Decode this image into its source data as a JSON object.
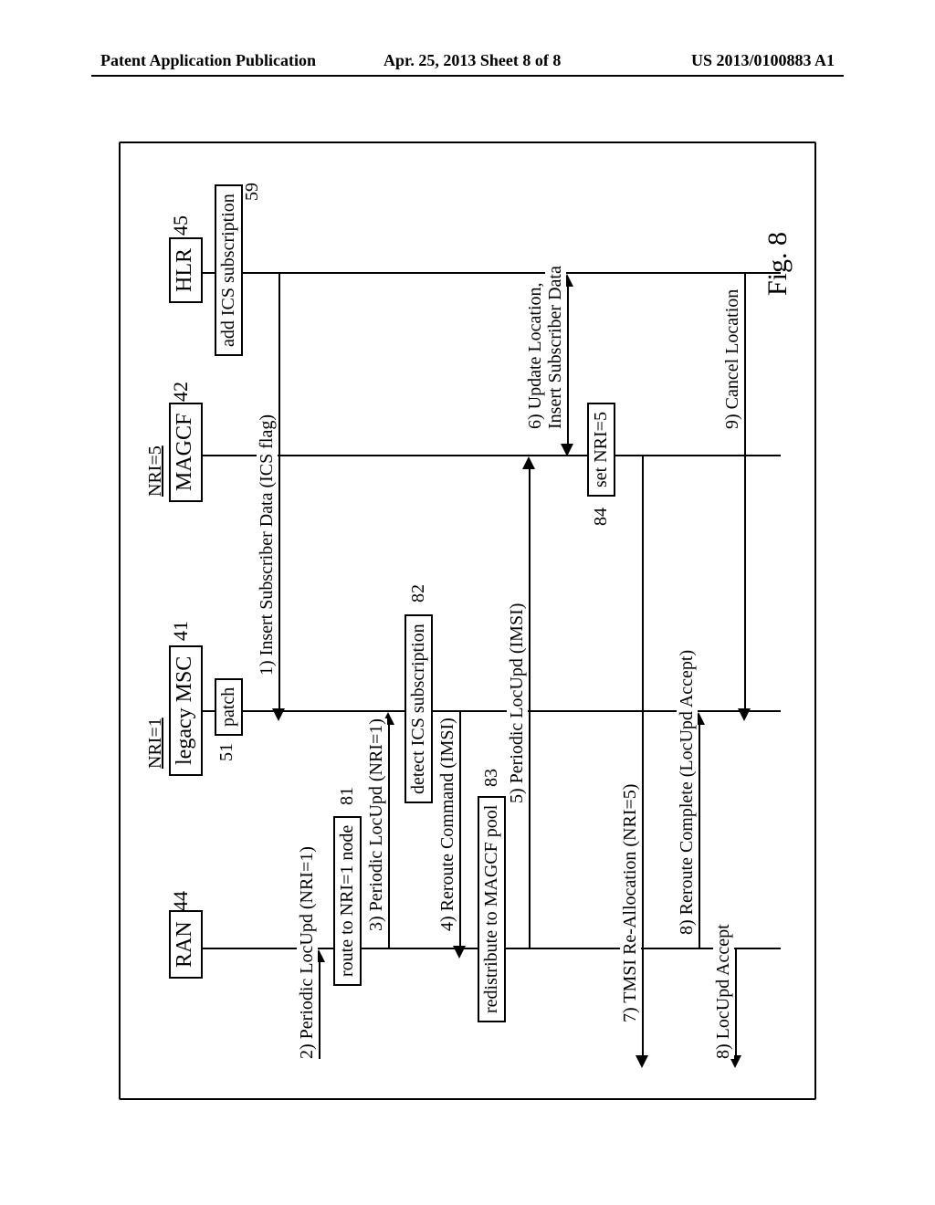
{
  "header": {
    "left": "Patent Application Publication",
    "center": "Apr. 25, 2013  Sheet 8 of 8",
    "right": "US 2013/0100883 A1"
  },
  "nodes": {
    "ran": {
      "label": "RAN",
      "num": "44",
      "nri": ""
    },
    "msc": {
      "label": "legacy MSC",
      "num": "41",
      "nri": "NRI=1"
    },
    "magcf": {
      "label": "MAGCF",
      "num": "42",
      "nri": "NRI=5"
    },
    "hlr": {
      "label": "HLR",
      "num": "45",
      "nri": ""
    }
  },
  "actions": {
    "patch": {
      "label": "patch",
      "num": "51"
    },
    "add_ics": {
      "label": "add ICS subscription",
      "num": "59"
    },
    "route_nri1": {
      "label": "route to NRI=1 node",
      "num": "81"
    },
    "detect_ics": {
      "label": "detect ICS subscription",
      "num": "82"
    },
    "redistribute": {
      "label": "redistribute to MAGCF pool",
      "num": "83"
    },
    "set_nri5": {
      "label": "set NRI=5",
      "num": "84"
    }
  },
  "messages": {
    "m1": "1) Insert Subscriber Data (ICS flag)",
    "m2": "2) Periodic LocUpd (NRI=1)",
    "m3": "3) Periodic LocUpd (NRI=1)",
    "m4": "4) Reroute Command (IMSI)",
    "m5": "5) Periodic LocUpd (IMSI)",
    "m6": "6) Update Location,",
    "m6b": "Insert Subscriber Data",
    "m7": "7) TMSI Re-Allocation (NRI=5)",
    "m8": "8) Reroute Complete (LocUpd Accept)",
    "m8b": "8) LocUpd Accept",
    "m9": "9) Cancel Location"
  },
  "figure_caption": "Fig. 8"
}
